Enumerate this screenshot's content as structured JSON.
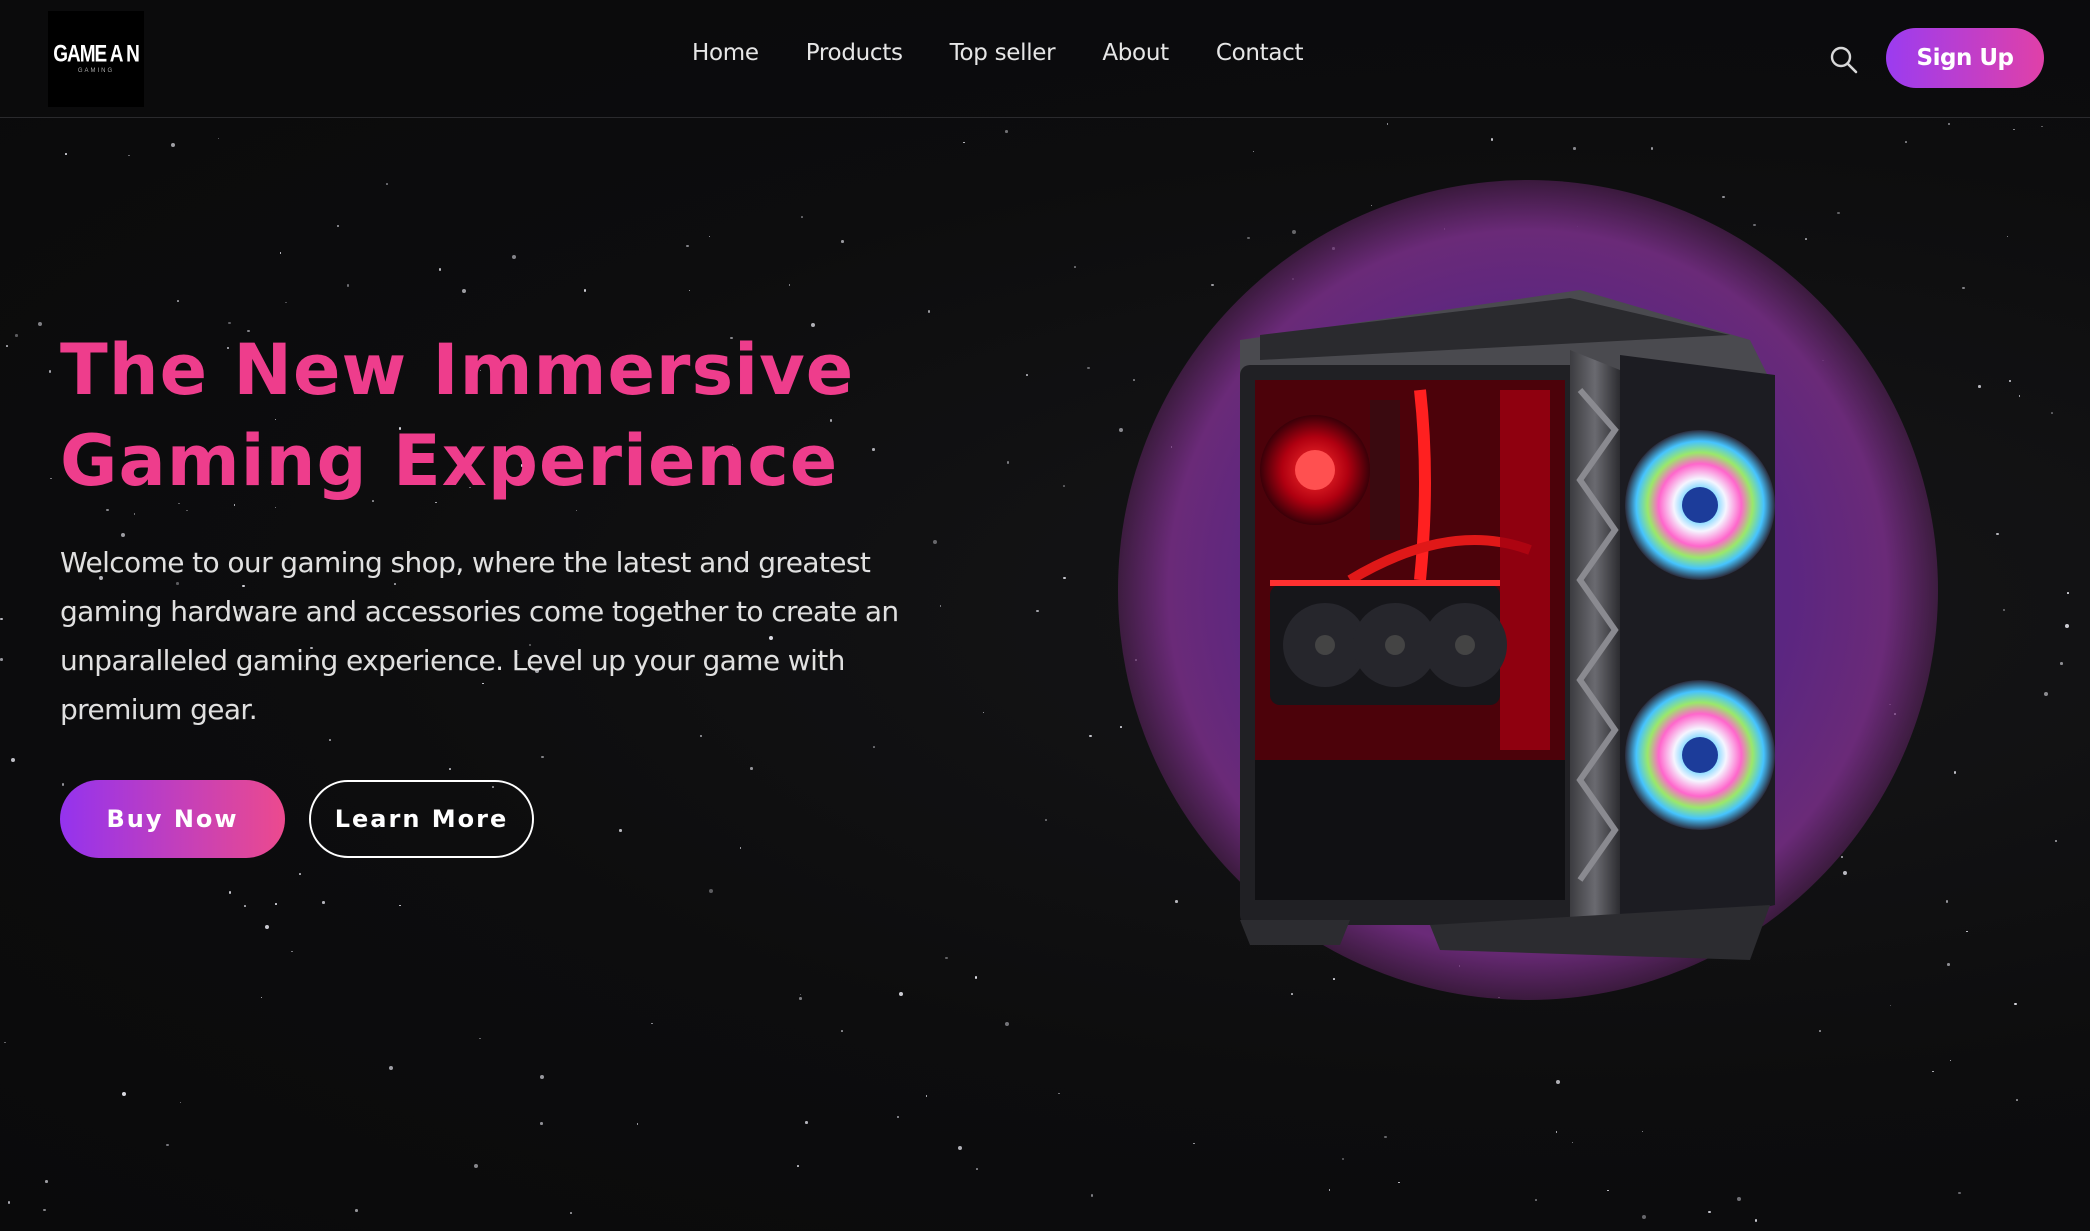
{
  "header": {
    "logo": {
      "main": "GAME A  N",
      "sub": "GAMING"
    },
    "nav": [
      {
        "label": "Home"
      },
      {
        "label": "Products"
      },
      {
        "label": "Top seller"
      },
      {
        "label": "About"
      },
      {
        "label": "Contact"
      }
    ],
    "search_icon": "search-icon",
    "signup_label": "Sign Up"
  },
  "hero": {
    "title_line1": "The New Immersive",
    "title_line2": "Gaming Experience",
    "description": "Welcome to our gaming shop, where the latest and greatest gaming hardware and accessories come together to create an unparalleled gaming experience. Level up your game with premium gear.",
    "buy_label": "Buy Now",
    "learn_label": "Learn More",
    "image": "gaming-pc-case-image"
  },
  "colors": {
    "background": "#0c0c0d",
    "accent_pink": "#ee3d8c",
    "accent_purple": "#9b3cf0",
    "glow_purple": "#5a2a8c"
  }
}
